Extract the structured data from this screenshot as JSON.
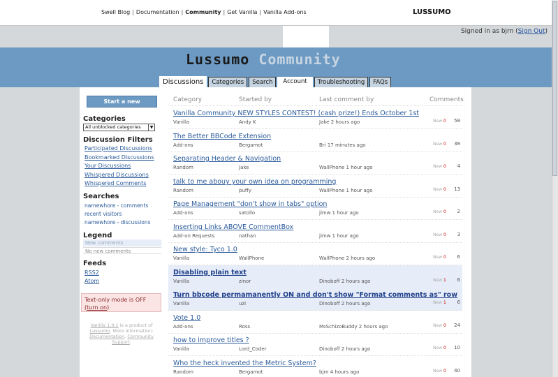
{
  "topnav": {
    "items": [
      "Swell Blog",
      "Documentation",
      "Community",
      "Get Vanilla",
      "Vanilla Add-ons"
    ],
    "current": "Community",
    "brand": "LUSSUMO"
  },
  "account": {
    "signed_prefix": "Signed in as bjrn (",
    "sign_out": "Sign Out",
    "signed_suffix": ")"
  },
  "site": {
    "title_main": "Lussumo",
    "title_sub": "Community"
  },
  "tabs": [
    "Discussions",
    "Categories",
    "Search",
    "Account",
    "Troubleshooting",
    "FAQs"
  ],
  "sidebar": {
    "start_button": "Start a new discussion",
    "categories_heading": "Categories",
    "category_select": "All unblocked categories",
    "filters_heading": "Discussion Filters",
    "filters": [
      "Participated Discussions",
      "Bookmarked Discussions",
      "Your Discussions",
      "Whispered Discussions",
      "Whispered Comments"
    ],
    "searches_heading": "Searches",
    "searches": [
      "namewhore - comments",
      "recent visitors",
      "namewhore - discussions"
    ],
    "legend_heading": "Legend",
    "legend": [
      "New comments",
      "No new comments"
    ],
    "feeds_heading": "Feeds",
    "feeds": [
      "RSS2",
      "Atom"
    ],
    "textonly_text": "Text-only mode is OFF",
    "textonly_open": "(",
    "textonly_link": "turn on",
    "textonly_close": ")",
    "footer": {
      "vanilla": "Vanilla 1.0.1",
      "prod": " is a product of ",
      "lussumo": "Lussumo",
      "more": ". More Information: ",
      "docs": "Documentation",
      "comma": ", ",
      "support": "Community Support",
      "end": "."
    }
  },
  "columns": [
    "Category",
    "Started by",
    "Last comment by",
    "Comments"
  ],
  "discussions": [
    {
      "title": "Vanilla Community NEW STYLES CONTEST! (cash prize!) Ends October 1st",
      "category": "Vanilla",
      "started_by": "Andy K",
      "last_comment": "Jake 2 hours ago",
      "new_label": "New",
      "new_count": "0",
      "comments": "58",
      "highlight": false
    },
    {
      "title": "The Better BBCode Extension",
      "category": "Add-ons",
      "started_by": "Bergamot",
      "last_comment": "Bri 17 minutes ago",
      "new_label": "New",
      "new_count": "0",
      "comments": "38",
      "highlight": false
    },
    {
      "title": "Separating Header & Navigation",
      "category": "Random",
      "started_by": "Jake",
      "last_comment": "WallPhone 1 hour ago",
      "new_label": "New",
      "new_count": "0",
      "comments": "4",
      "highlight": false
    },
    {
      "title": "talk to me abouy your own idea on programming",
      "category": "Random",
      "started_by": "puffy",
      "last_comment": "WallPhone 1 hour ago",
      "new_label": "New",
      "new_count": "0",
      "comments": "13",
      "highlight": false
    },
    {
      "title": "Page Management \"don't show in tabs\" option",
      "category": "Add-ons",
      "started_by": "satollo",
      "last_comment": "jimw 1 hour ago",
      "new_label": "New",
      "new_count": "0",
      "comments": "2",
      "highlight": false
    },
    {
      "title": "Inserting Links ABOVE CommentBox",
      "category": "Add-on Requests",
      "started_by": "nathan",
      "last_comment": "jimw 1 hour ago",
      "new_label": "New",
      "new_count": "0",
      "comments": "3",
      "highlight": false
    },
    {
      "title": "New style: Tyco 1.0",
      "category": "Vanilla",
      "started_by": "WallPhone",
      "last_comment": "WallPhone 2 hours ago",
      "new_label": "New",
      "new_count": "0",
      "comments": "6",
      "highlight": false
    },
    {
      "title": "Disabling plain text",
      "category": "Vanilla",
      "started_by": "zinor",
      "last_comment": "Dinoboff 2 hours ago",
      "new_label": "New",
      "new_count": "1",
      "comments": "6",
      "highlight": true
    },
    {
      "title": "Turn bbcode permamanently ON and don't show \"Format comments as\" row",
      "category": "Vanilla",
      "started_by": "uzi",
      "last_comment": "Dinoboff 2 hours ago",
      "new_label": "New",
      "new_count": "1",
      "comments": "6",
      "highlight": true
    },
    {
      "title": "Vote 1.0",
      "category": "Add-ons",
      "started_by": "Ross",
      "last_comment": "MsSchizoBuddy 2 hours ago",
      "new_label": "New",
      "new_count": "0",
      "comments": "24",
      "highlight": false
    },
    {
      "title": "how to improve titles ?",
      "category": "Vanilla",
      "started_by": "Lord_Coder",
      "last_comment": "Dinoboff 2 hours ago",
      "new_label": "New",
      "new_count": "0",
      "comments": "10",
      "highlight": false
    },
    {
      "title": "Who the heck invented the Metric System?",
      "category": "Random",
      "started_by": "Bergamot",
      "last_comment": "bjrn 4 hours ago",
      "new_label": "New",
      "new_count": "0",
      "comments": "40",
      "highlight": false
    }
  ]
}
